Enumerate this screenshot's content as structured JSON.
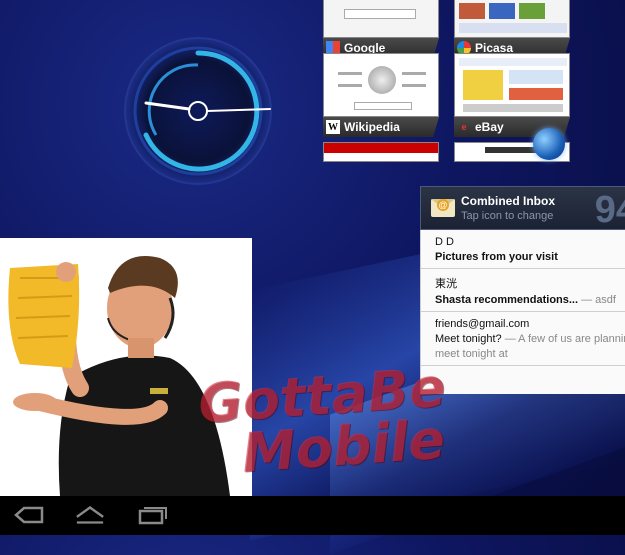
{
  "bookmarks": [
    {
      "label": "Google",
      "icon": "google-icon"
    },
    {
      "label": "Picasa",
      "icon": "picasa-icon"
    },
    {
      "label": "Wikipedia",
      "icon": "wikipedia-icon"
    },
    {
      "label": "eBay",
      "icon": "ebay-icon"
    },
    {
      "label": "",
      "icon": "cnn-thumbnail"
    },
    {
      "label": "",
      "icon": "nytimes-thumbnail"
    }
  ],
  "email_widget": {
    "title": "Combined Inbox",
    "subtitle": "Tap icon to change",
    "count": "94",
    "items": [
      {
        "from": "D D",
        "subject": "Pictures from your visit",
        "snippet": ""
      },
      {
        "from": "東洸",
        "subject": "Shasta recommendations...",
        "snippet": " — asdf"
      },
      {
        "from": "friends@gmail.com",
        "subject": "Meet tonight?",
        "snippet": " — A few of us are planning to",
        "extra": "meet tonight at"
      }
    ]
  },
  "watermark": {
    "line1": "GottaBe",
    "line2": "Mobile"
  },
  "colors": {
    "accent": "#33b5e5",
    "watermark": "#d2283c",
    "navbar": "#000000"
  }
}
